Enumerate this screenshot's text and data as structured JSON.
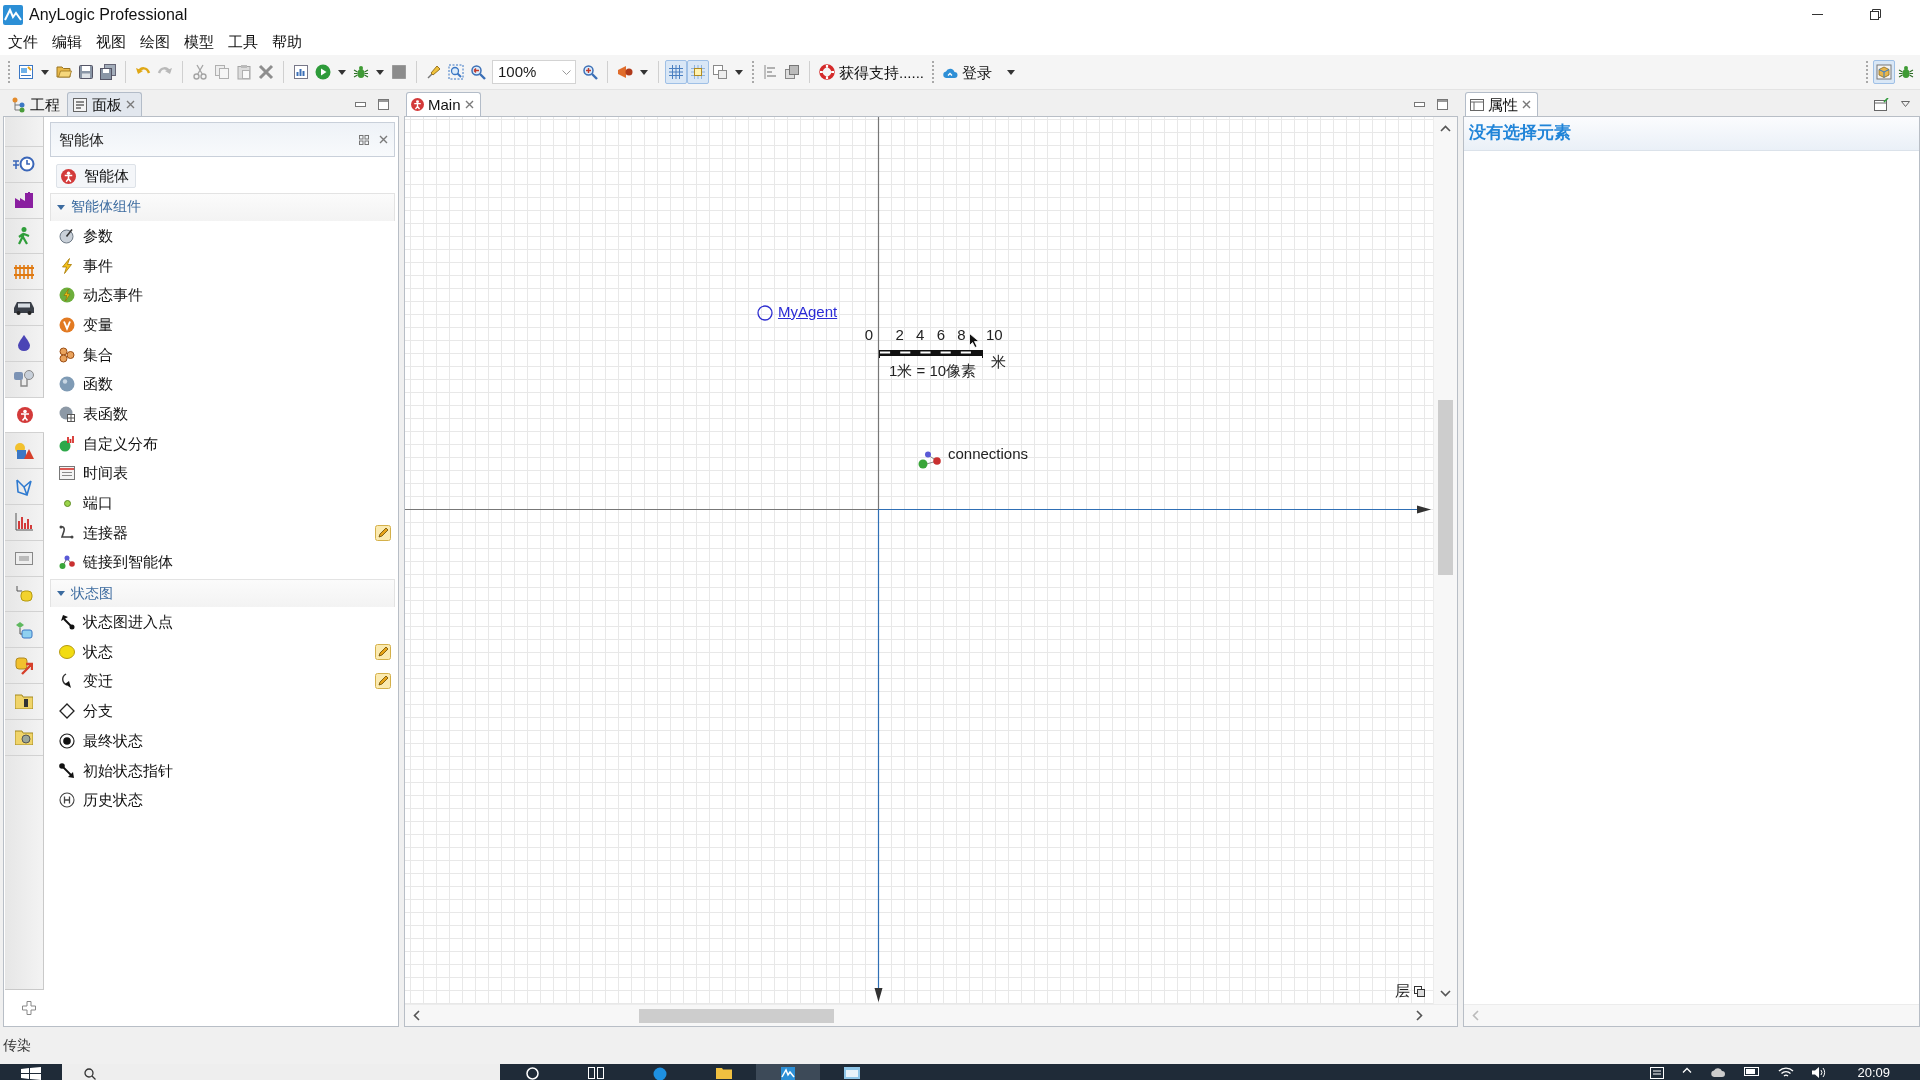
{
  "window": {
    "title": "AnyLogic Professional"
  },
  "menu": [
    "文件",
    "编辑",
    "视图",
    "绘图",
    "模型",
    "工具",
    "帮助"
  ],
  "toolbar": {
    "zoom": "100%",
    "grid_button": {
      "selected": true
    },
    "snap_button": {
      "selected": true
    },
    "support_label": "获得支持......",
    "login_label": "登录",
    "perspective_button": {
      "selected": true
    }
  },
  "left_panel": {
    "tabs": [
      {
        "label": "工程",
        "selected": false
      },
      {
        "label": "面板",
        "selected": true
      }
    ],
    "palette_strip": [
      {
        "selected": false
      },
      {
        "selected": false
      },
      {
        "selected": false
      },
      {
        "selected": false
      },
      {
        "selected": false
      },
      {
        "selected": false
      },
      {
        "selected": false
      },
      {
        "selected": true
      },
      {
        "selected": false
      },
      {
        "selected": false
      },
      {
        "selected": false
      },
      {
        "selected": false
      },
      {
        "selected": false
      },
      {
        "selected": false
      },
      {
        "selected": false
      },
      {
        "selected": false
      },
      {
        "selected": false
      }
    ],
    "palette": {
      "title": "智能体",
      "agent_button": "智能体",
      "sections": [
        {
          "title": "智能体组件",
          "expanded": true,
          "items": [
            {
              "label": "参数",
              "drawing_mode": false
            },
            {
              "label": "事件",
              "drawing_mode": false
            },
            {
              "label": "动态事件",
              "drawing_mode": false
            },
            {
              "label": "变量",
              "drawing_mode": false
            },
            {
              "label": "集合",
              "drawing_mode": false
            },
            {
              "label": "函数",
              "drawing_mode": false
            },
            {
              "label": "表函数",
              "drawing_mode": false
            },
            {
              "label": "自定义分布",
              "drawing_mode": false
            },
            {
              "label": "时间表",
              "drawing_mode": false
            },
            {
              "label": "端口",
              "drawing_mode": false
            },
            {
              "label": "连接器",
              "drawing_mode": true
            },
            {
              "label": "链接到智能体",
              "drawing_mode": false
            }
          ]
        },
        {
          "title": "状态图",
          "expanded": true,
          "items": [
            {
              "label": "状态图进入点",
              "drawing_mode": false
            },
            {
              "label": "状态",
              "drawing_mode": true
            },
            {
              "label": "变迁",
              "drawing_mode": true
            },
            {
              "label": "分支",
              "drawing_mode": false
            },
            {
              "label": "最终状态",
              "drawing_mode": false
            },
            {
              "label": "初始状态指针",
              "drawing_mode": false
            },
            {
              "label": "历史状态",
              "drawing_mode": false
            }
          ]
        }
      ]
    }
  },
  "editor": {
    "tabs": [
      {
        "label": "Main",
        "selected": true
      }
    ],
    "canvas": {
      "agent_label": "MyAgent",
      "scale": {
        "ticks": [
          "0",
          "2",
          "4",
          "6",
          "8",
          "10"
        ],
        "unit": "米",
        "caption": "1米 = 10像素"
      },
      "connections_label": "connections",
      "layers_label": "层"
    }
  },
  "properties": {
    "tabs": [
      {
        "label": "属性",
        "selected": true
      }
    ],
    "message": "没有选择元素"
  },
  "status_bar": {
    "text": "传染"
  },
  "taskbar": {
    "time": "20:09"
  }
}
